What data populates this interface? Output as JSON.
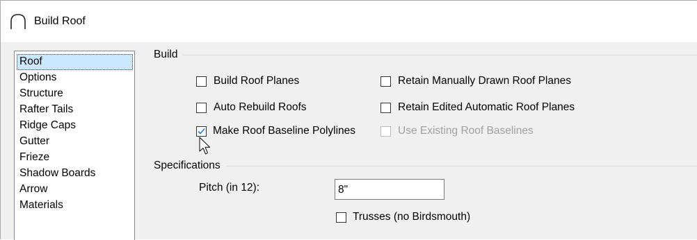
{
  "window": {
    "title": "Build Roof"
  },
  "nav": {
    "items": [
      {
        "label": "Roof",
        "selected": true
      },
      {
        "label": "Options"
      },
      {
        "label": "Structure"
      },
      {
        "label": "Rafter Tails"
      },
      {
        "label": "Ridge Caps"
      },
      {
        "label": "Gutter"
      },
      {
        "label": "Frieze"
      },
      {
        "label": "Shadow Boards"
      },
      {
        "label": "Arrow"
      },
      {
        "label": "Materials"
      }
    ]
  },
  "build": {
    "title": "Build",
    "build_roof_planes": {
      "label": "Build Roof Planes",
      "checked": false
    },
    "auto_rebuild_roofs": {
      "label": "Auto Rebuild Roofs",
      "checked": false
    },
    "make_roof_baseline_polylines": {
      "label": "Make Roof Baseline Polylines",
      "checked": true
    },
    "retain_manually_drawn": {
      "label": "Retain Manually Drawn Roof Planes",
      "checked": false
    },
    "retain_edited_automatic": {
      "label": "Retain Edited Automatic Roof Planes",
      "checked": false
    },
    "use_existing_baselines": {
      "label": "Use Existing Roof Baselines",
      "checked": false,
      "disabled": true
    }
  },
  "specifications": {
    "title": "Specifications",
    "pitch_label": "Pitch (in 12):",
    "pitch_value": "8\"",
    "trusses": {
      "label": "Trusses (no Birdsmouth)",
      "checked": false
    }
  },
  "icons": {
    "title_icon": "roof-arc-icon",
    "cursor": "mouse-pointer-icon",
    "check": "checkmark-icon"
  },
  "colors": {
    "selection": "#cce8ff",
    "checkmark": "#2b79d6",
    "disabled_text": "#a0a0a0"
  }
}
